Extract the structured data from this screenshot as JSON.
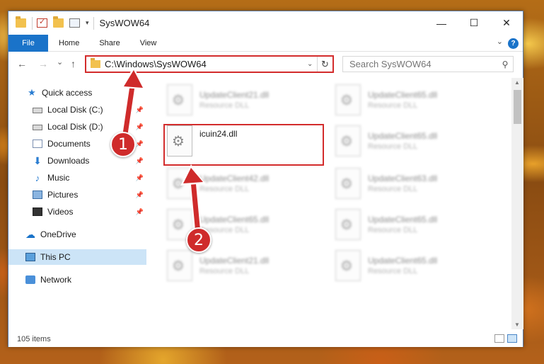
{
  "window": {
    "title": "SysWOW64",
    "controls": {
      "minimize": "—",
      "maximize": "☐",
      "close": "✕"
    }
  },
  "ribbon": {
    "file_tab": "File",
    "tabs": [
      "Home",
      "Share",
      "View"
    ],
    "help": "?"
  },
  "address": {
    "path": "C:\\Windows\\SysWOW64",
    "refresh_icon": "refresh-icon"
  },
  "search": {
    "placeholder": "Search SysWOW64"
  },
  "nav": {
    "back": "←",
    "forward": "→",
    "recent": "⌄",
    "up": "↑"
  },
  "sidebar": {
    "items": [
      {
        "label": "Quick access",
        "icon": "star-icon",
        "pinned": false
      },
      {
        "label": "Local Disk (C:)",
        "icon": "disk-icon",
        "pinned": true
      },
      {
        "label": "Local Disk (D:)",
        "icon": "disk-icon",
        "pinned": true
      },
      {
        "label": "Documents",
        "icon": "documents-icon",
        "pinned": true
      },
      {
        "label": "Downloads",
        "icon": "download-icon",
        "pinned": true
      },
      {
        "label": "Music",
        "icon": "music-icon",
        "pinned": true
      },
      {
        "label": "Pictures",
        "icon": "pictures-icon",
        "pinned": true
      },
      {
        "label": "Videos",
        "icon": "videos-icon",
        "pinned": true
      },
      {
        "label": "OneDrive",
        "icon": "cloud-icon",
        "pinned": false
      },
      {
        "label": "This PC",
        "icon": "pc-icon",
        "pinned": false,
        "selected": true
      },
      {
        "label": "Network",
        "icon": "network-icon",
        "pinned": false
      }
    ]
  },
  "files": {
    "left": [
      {
        "name": "UpdateClient21.dll",
        "type": "Resource DLL",
        "blurred": true
      },
      {
        "name": "icuin24.dll",
        "type": "",
        "blurred": false
      },
      {
        "name": "UpdateClient42.dll",
        "type": "Resource DLL",
        "blurred": true
      },
      {
        "name": "UpdateClient65.dll",
        "type": "Resource DLL",
        "blurred": true
      },
      {
        "name": "UpdateClient21.dll",
        "type": "Resource DLL",
        "blurred": true
      }
    ],
    "right": [
      {
        "name": "UpdateClient65.dll",
        "type": "Resource DLL",
        "blurred": true
      },
      {
        "name": "UpdateClient65.dll",
        "type": "Resource DLL",
        "blurred": true
      },
      {
        "name": "UpdateClient63.dll",
        "type": "Resource DLL",
        "blurred": true
      },
      {
        "name": "UpdateClient65.dll",
        "type": "Resource DLL",
        "blurred": true
      },
      {
        "name": "UpdateClient65.dll",
        "type": "Resource DLL",
        "blurred": true
      }
    ]
  },
  "status": {
    "item_count": "105 items"
  },
  "callouts": {
    "one": "1",
    "two": "2"
  },
  "colors": {
    "accent": "#1a73c9",
    "highlight_red": "#d32c2c",
    "callout_red": "#cf2b2b",
    "selection": "#cce4f7"
  }
}
